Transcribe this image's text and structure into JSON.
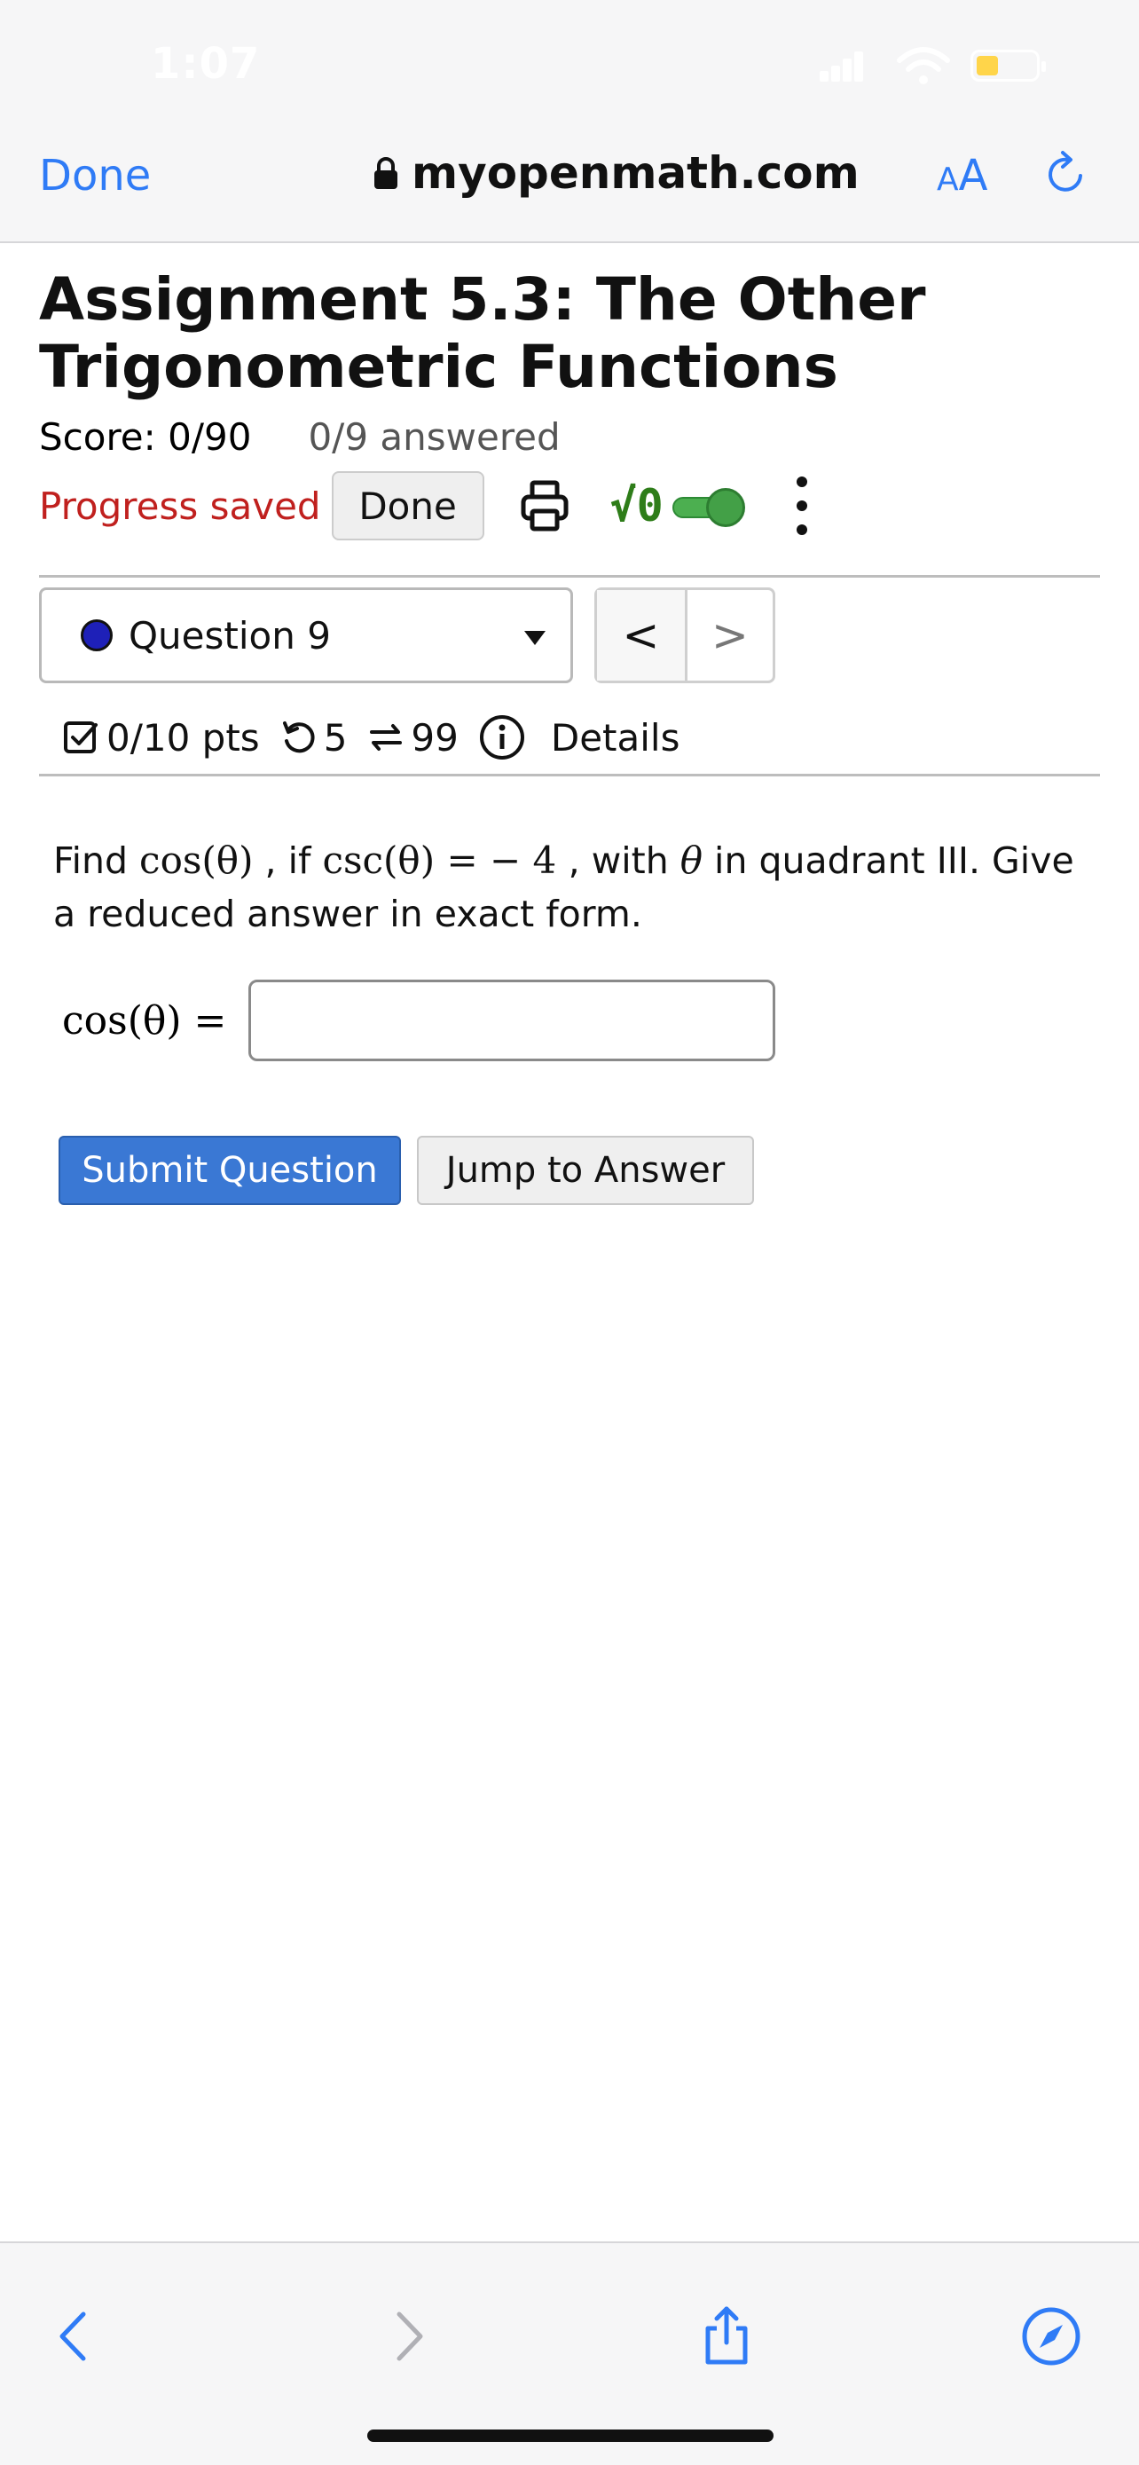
{
  "status_bar": {
    "time": "1:07"
  },
  "browser": {
    "done_label": "Done",
    "url": "myopenmath.com",
    "text_size_small": "A",
    "text_size_large": "A"
  },
  "assignment": {
    "title": "Assignment 5.3: The Other Trigonometric Functions",
    "score": "Score: 0/90",
    "answered": "0/9 answered",
    "progress_saved": "Progress saved",
    "done_button": "Done",
    "math_toggle_label": "√0"
  },
  "question_nav": {
    "selected": "Question 9",
    "prev": "<",
    "next": ">"
  },
  "meta": {
    "points": "0/10 pts",
    "retries": "5",
    "attempts": "99",
    "details": "Details"
  },
  "question": {
    "find": "Find ",
    "cos_expr": "cos(θ)",
    "comma_if": " , if ",
    "csc_expr": "csc(θ)",
    "equals": " = ",
    "value": " − 4 ",
    "with": ", with ",
    "theta": "θ",
    "quadrant": " in quadrant III.   Give a reduced answer in exact form.",
    "answer_label": "cos(θ)  =",
    "answer_value": ""
  },
  "buttons": {
    "submit": "Submit Question",
    "jump": "Jump to Answer"
  },
  "colors": {
    "link_blue": "#2f7bf6",
    "progress_red": "#c0201e",
    "submit_blue": "#3a78d4",
    "toggle_green": "#43a047",
    "question_dot": "#1e20b8"
  }
}
